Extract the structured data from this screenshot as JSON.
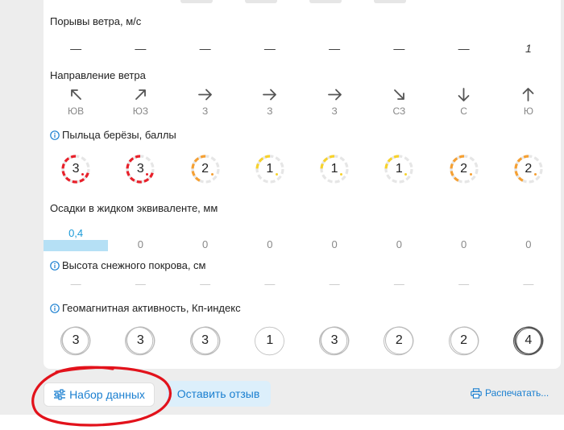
{
  "wind_gusts": {
    "title": "Порывы ветра, м/с",
    "values": [
      "—",
      "—",
      "—",
      "—",
      "—",
      "—",
      "—",
      "1"
    ]
  },
  "wind_direction": {
    "title": "Направление ветра",
    "items": [
      {
        "icon": "arrow-up-left-icon",
        "label": "ЮВ"
      },
      {
        "icon": "arrow-up-right-icon",
        "label": "ЮЗ"
      },
      {
        "icon": "arrow-right-icon",
        "label": "З"
      },
      {
        "icon": "arrow-right-icon",
        "label": "З"
      },
      {
        "icon": "arrow-right-icon",
        "label": "З"
      },
      {
        "icon": "arrow-down-right-icon",
        "label": "СЗ"
      },
      {
        "icon": "arrow-down-icon",
        "label": "С"
      },
      {
        "icon": "arrow-up-icon",
        "label": "Ю"
      }
    ]
  },
  "birch_pollen": {
    "title": "Пыльца берёзы, баллы",
    "values": [
      "3",
      "3",
      "2",
      "1",
      "1",
      "1",
      "2",
      "2"
    ],
    "colors": {
      "3": "#e8202a",
      "2": "#f5a033",
      "1": "#f7d22c",
      "track": "#e6e6e6"
    }
  },
  "precipitation": {
    "title": "Осадки в жидком эквиваленте, мм",
    "values": [
      "0,4",
      "0",
      "0",
      "0",
      "0",
      "0",
      "0",
      "0"
    ]
  },
  "snow_cover": {
    "title": "Высота снежного покрова, см",
    "values": [
      "—",
      "—",
      "—",
      "—",
      "—",
      "—",
      "—",
      "—"
    ]
  },
  "geomagnetic": {
    "title": "Геомагнитная активность, Кп-индекс",
    "values": [
      "3",
      "3",
      "3",
      "1",
      "3",
      "2",
      "2",
      "4"
    ]
  },
  "footer": {
    "dataset_button": "Набор данных",
    "feedback_button": "Оставить отзыв",
    "print_link": "Распечатать..."
  },
  "colors": {
    "accent": "#1a7fd0",
    "annotation_red": "#e2121b",
    "precip_bar": "#b5e0f5"
  }
}
